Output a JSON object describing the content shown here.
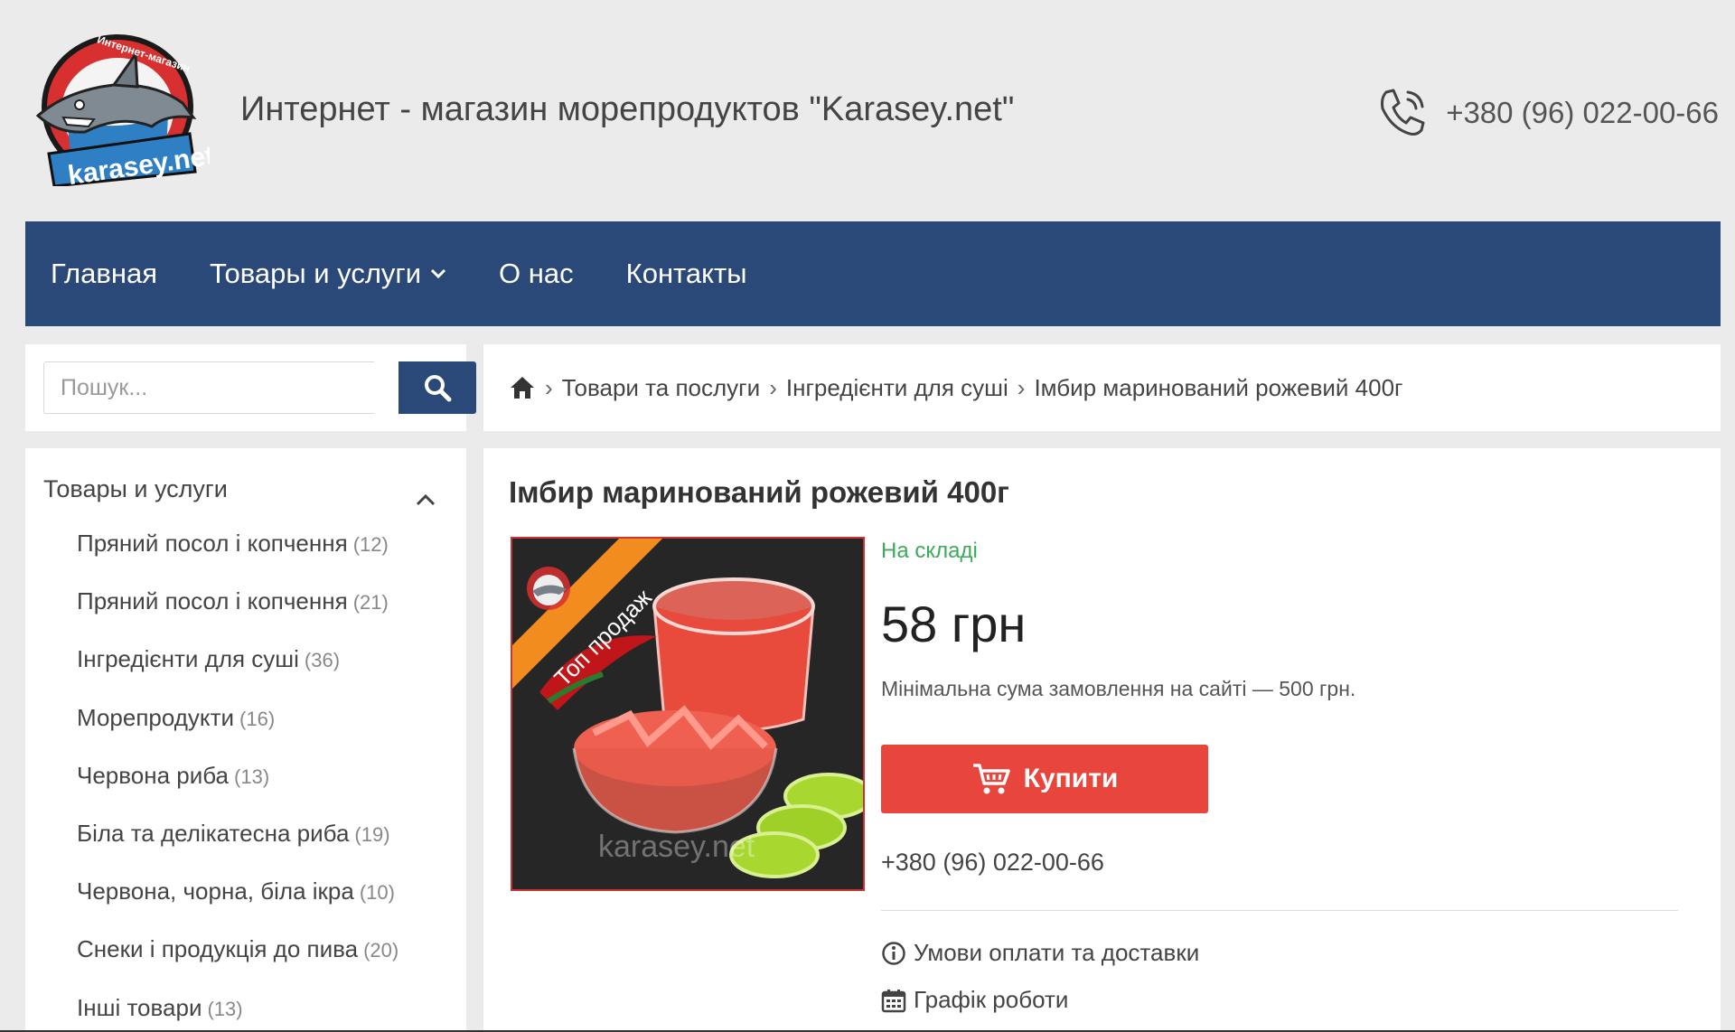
{
  "header": {
    "title": "Интернет - магазин морепродуктов \"Karasey.net\"",
    "phone": "+380 (96) 022-00-66",
    "logo": {
      "top_text": "Интернет-магазин",
      "brand": "karasey.net"
    }
  },
  "nav": {
    "items": [
      {
        "label": "Главная"
      },
      {
        "label": "Товары и услуги"
      },
      {
        "label": "О нас"
      },
      {
        "label": "Контакты"
      }
    ]
  },
  "search": {
    "placeholder": "Пошук..."
  },
  "breadcrumb": {
    "items": [
      "Товари та послуги",
      "Інгредієнти для суші",
      "Імбир маринований рожевий 400г"
    ]
  },
  "sidebar": {
    "title": "Товары и услуги",
    "categories": [
      {
        "label": "Пряний посол і копчення",
        "count": "(12)"
      },
      {
        "label": "Пряний посол і копчення",
        "count": "(21)"
      },
      {
        "label": "Інгредієнти для суші",
        "count": "(36)"
      },
      {
        "label": "Морепродукти",
        "count": "(16)"
      },
      {
        "label": "Червона риба",
        "count": "(13)"
      },
      {
        "label": "Біла та делікатесна риба",
        "count": "(19)"
      },
      {
        "label": "Червона, чорна, біла ікра",
        "count": "(10)"
      },
      {
        "label": "Снеки і продукція до пива",
        "count": "(20)"
      },
      {
        "label": "Інші товари",
        "count": "(13)"
      }
    ]
  },
  "product": {
    "title": "Імбир маринований рожевий 400г",
    "badge": "Топ продаж",
    "watermark": "karasey.net",
    "stock": "На складі",
    "price": "58 грн",
    "min_order": "Мінімальна сума замовлення на сайті — 500 грн.",
    "buy_label": "Купити",
    "phone": "+380 (96) 022-00-66",
    "links": [
      {
        "label": "Умови оплати та доставки"
      },
      {
        "label": "Графік роботи"
      }
    ]
  },
  "colors": {
    "nav_bg": "#2b4978",
    "buy_button": "#e8453c",
    "stock_green": "#3caa5a",
    "page_bg": "#ebebeb"
  }
}
